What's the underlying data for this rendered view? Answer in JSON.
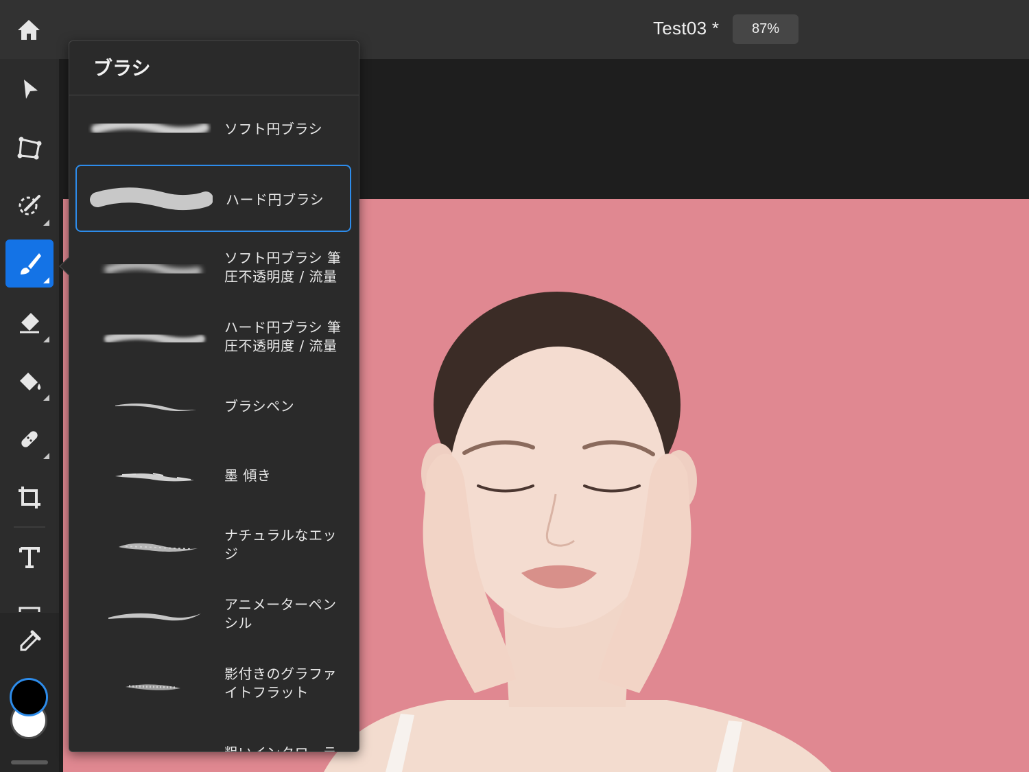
{
  "topbar": {
    "doc_title": "Test03 *",
    "zoom": "87%"
  },
  "toolbar": {
    "tools": [
      "home-icon",
      "select-arrow-icon",
      "transform-icon",
      "quick-select-icon",
      "brush-icon",
      "eraser-icon",
      "paint-bucket-icon",
      "healing-icon",
      "crop-icon",
      "type-icon",
      "image-icon",
      "eyedropper-icon"
    ],
    "active_tool": "brush-icon",
    "foreground_color": "#000000",
    "background_color": "#ffffff"
  },
  "panel": {
    "title": "ブラシ",
    "brushes": [
      {
        "label": "ソフト円ブラシ",
        "selected": false
      },
      {
        "label": "ハード円ブラシ",
        "selected": true
      },
      {
        "label": "ソフト円ブラシ 筆圧不透明度 / 流量",
        "selected": false
      },
      {
        "label": "ハード円ブラシ 筆圧不透明度 / 流量",
        "selected": false
      },
      {
        "label": "ブラシペン",
        "selected": false
      },
      {
        "label": "墨 傾き",
        "selected": false
      },
      {
        "label": "ナチュラルなエッジ",
        "selected": false
      },
      {
        "label": "アニメーターペンシル",
        "selected": false
      },
      {
        "label": "影付きのグラファイトフラット",
        "selected": false
      },
      {
        "label": "粗いインクローラ",
        "selected": false
      }
    ]
  },
  "canvas": {
    "background_color": "#e08891"
  }
}
